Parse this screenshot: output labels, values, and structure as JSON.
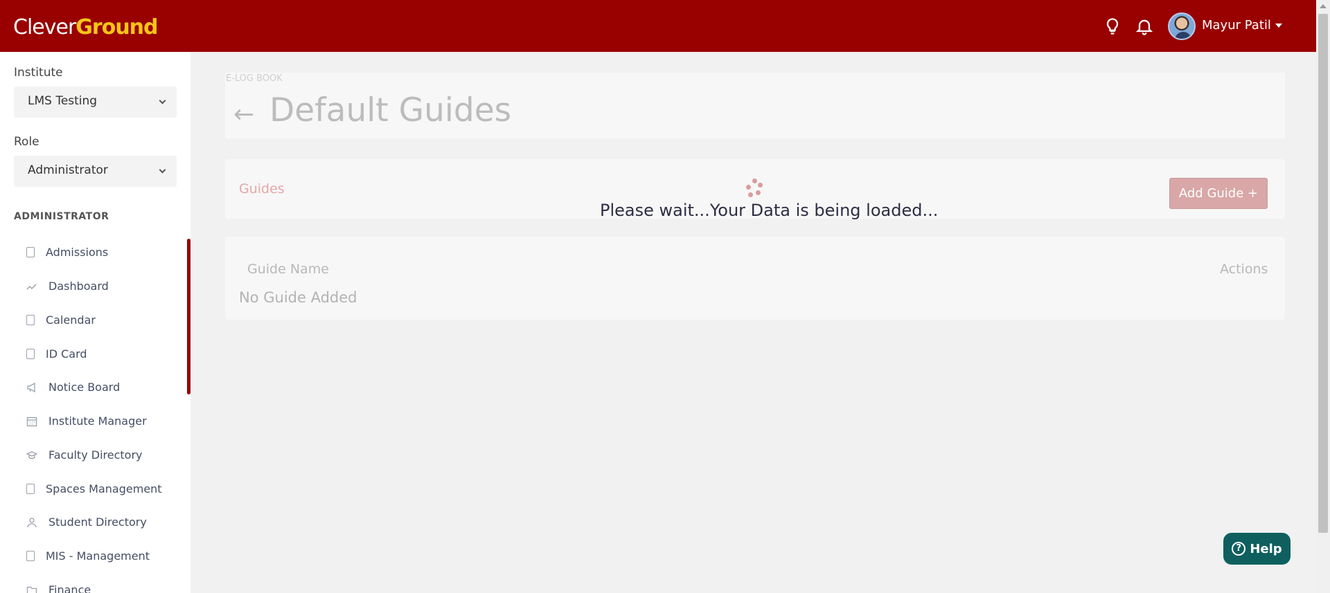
{
  "app": {
    "logo_left": "Clever",
    "logo_right": "Ground",
    "user_name": "Mayur Patil"
  },
  "sidebar": {
    "institute_label": "Institute",
    "institute_value": "LMS Testing",
    "role_label": "Role",
    "role_value": "Administrator",
    "section_title": "ADMINISTRATOR",
    "items": [
      {
        "label": "Admissions",
        "icon": "book-icon"
      },
      {
        "label": "Dashboard",
        "icon": "trend-icon"
      },
      {
        "label": "Calendar",
        "icon": "book-icon"
      },
      {
        "label": "ID Card",
        "icon": "book-icon"
      },
      {
        "label": "Notice Board",
        "icon": "megaphone-icon"
      },
      {
        "label": "Institute Manager",
        "icon": "calendar-grid-icon"
      },
      {
        "label": "Faculty Directory",
        "icon": "graduation-cap-icon"
      },
      {
        "label": "Spaces Management",
        "icon": "book-icon"
      },
      {
        "label": "Student Directory",
        "icon": "person-icon"
      },
      {
        "label": "MIS - Management",
        "icon": "book-icon"
      },
      {
        "label": "Finance",
        "icon": "folder-icon"
      }
    ]
  },
  "main": {
    "breadcrumb": "E-LOG BOOK",
    "title": "Default Guides",
    "tab_label": "Guides",
    "add_button": "Add Guide +",
    "loading_text": "Please wait...Your Data is being loaded...",
    "table": {
      "headers": [
        "Guide Name",
        "Actions"
      ],
      "empty_text": "No Guide Added"
    }
  },
  "help": {
    "label": "Help"
  },
  "colors": {
    "brand": "#990000",
    "accent_yellow": "#f5c518",
    "help_bg": "#0f5f5f"
  }
}
